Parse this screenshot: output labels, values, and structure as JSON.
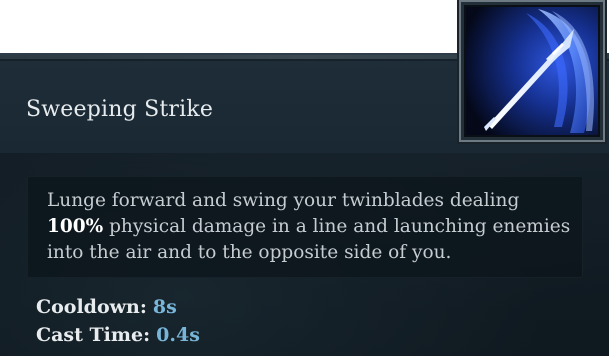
{
  "ability": {
    "name": "Sweeping Strike",
    "icon": "spear-sweep-icon",
    "description": {
      "before": "Lunge forward and swing your twinblades dealing ",
      "highlight": "100%",
      "after": " physical damage in a line and launching enemies into the air and to the opposite side of you."
    },
    "stats": [
      {
        "label": "Cooldown:",
        "value": "8s"
      },
      {
        "label": "Cast Time:",
        "value": "0.4s"
      }
    ]
  },
  "colors": {
    "background": "#111b23",
    "header": "#1e2d38",
    "title_text": "#e6ebee",
    "body_text": "#c6cdd1",
    "stat_value": "#78b6d9",
    "icon_glow": "#3f73ff"
  }
}
